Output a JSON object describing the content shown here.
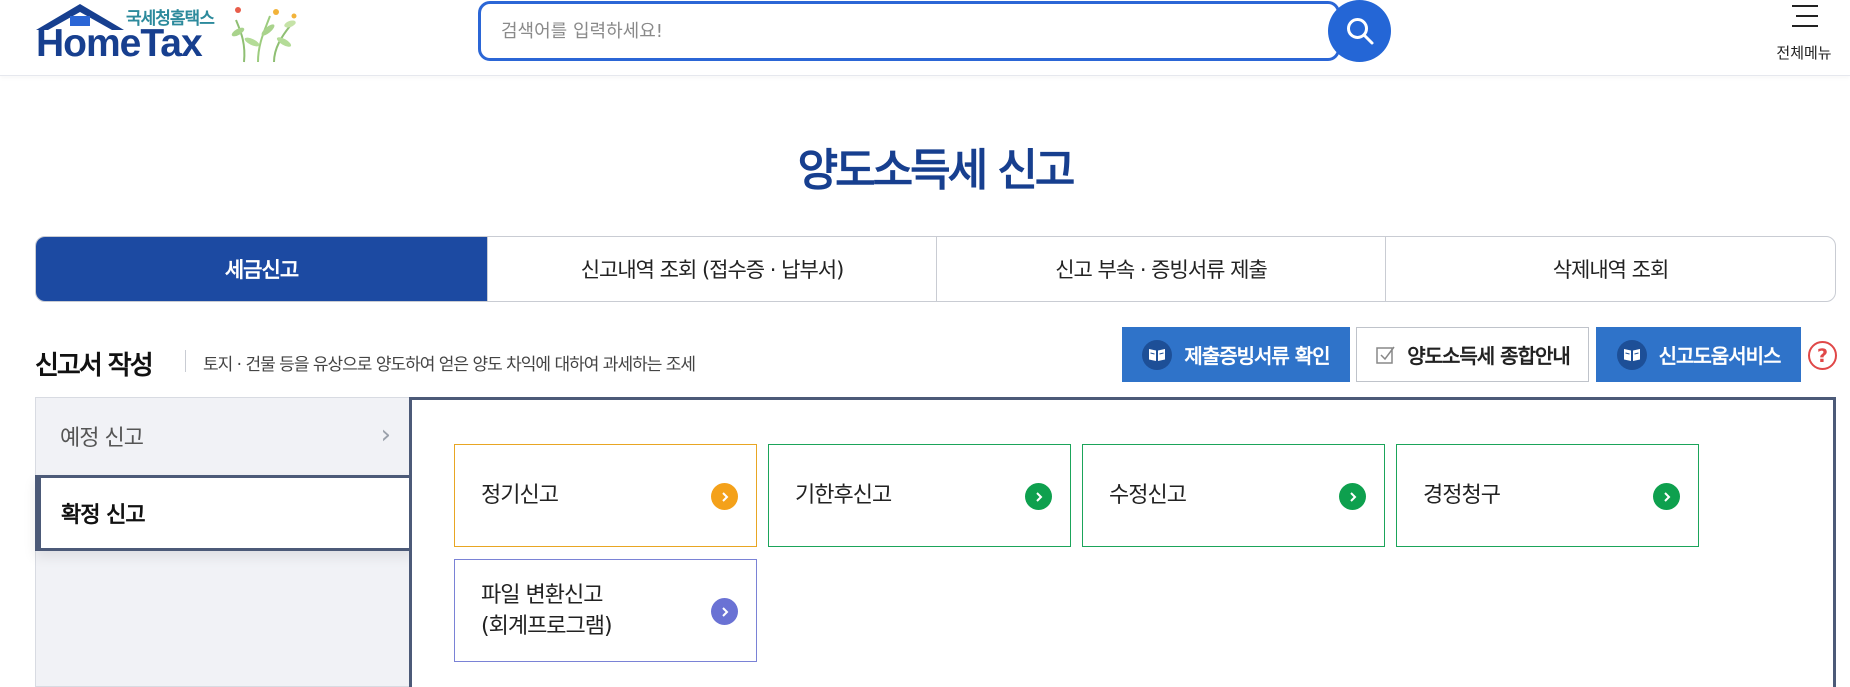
{
  "header": {
    "logo_subtitle": "국세청홈택스",
    "logo_title": "HomeTax",
    "search_placeholder": "검색어를 입력하세요!",
    "menu_label": "전체메뉴"
  },
  "page_title": "양도소득세 신고",
  "tabs": [
    {
      "label": "세금신고",
      "active": true
    },
    {
      "label": "신고내역 조회 (접수증 · 납부서)",
      "active": false
    },
    {
      "label": "신고 부속 · 증빙서류 제출",
      "active": false
    },
    {
      "label": "삭제내역 조회",
      "active": false
    }
  ],
  "section": {
    "title": "신고서 작성",
    "description": "토지 · 건물 등을 유상으로 양도하여 얻은 양도 차익에 대하여 과세하는 조세",
    "buttons": [
      {
        "label": "제출증빙서류 확인",
        "style": "blue",
        "icon": "book-icon"
      },
      {
        "label": "양도소득세 종합안내",
        "style": "white",
        "icon": "checkbox-icon"
      },
      {
        "label": "신고도움서비스",
        "style": "blue",
        "icon": "book-icon"
      }
    ],
    "help_label": "?"
  },
  "sidebar": {
    "items": [
      {
        "label": "예정 신고",
        "active": false
      },
      {
        "label": "확정 신고",
        "active": true
      }
    ]
  },
  "cards": [
    {
      "label": "정기신고",
      "color": "#f4a11a"
    },
    {
      "label": "기한후신고",
      "color": "#0ea04e"
    },
    {
      "label": "수정신고",
      "color": "#0ea04e"
    },
    {
      "label": "경정청구",
      "color": "#0ea04e"
    },
    {
      "label_line1": "파일 변환신고",
      "label_line2": "(회계프로그램)",
      "color": "#6a72d4"
    }
  ],
  "colors": {
    "brand_navy": "#173f8f",
    "active_tab": "#1c4aa2",
    "search_blue": "#2466d6",
    "button_blue": "#2f73c9"
  }
}
